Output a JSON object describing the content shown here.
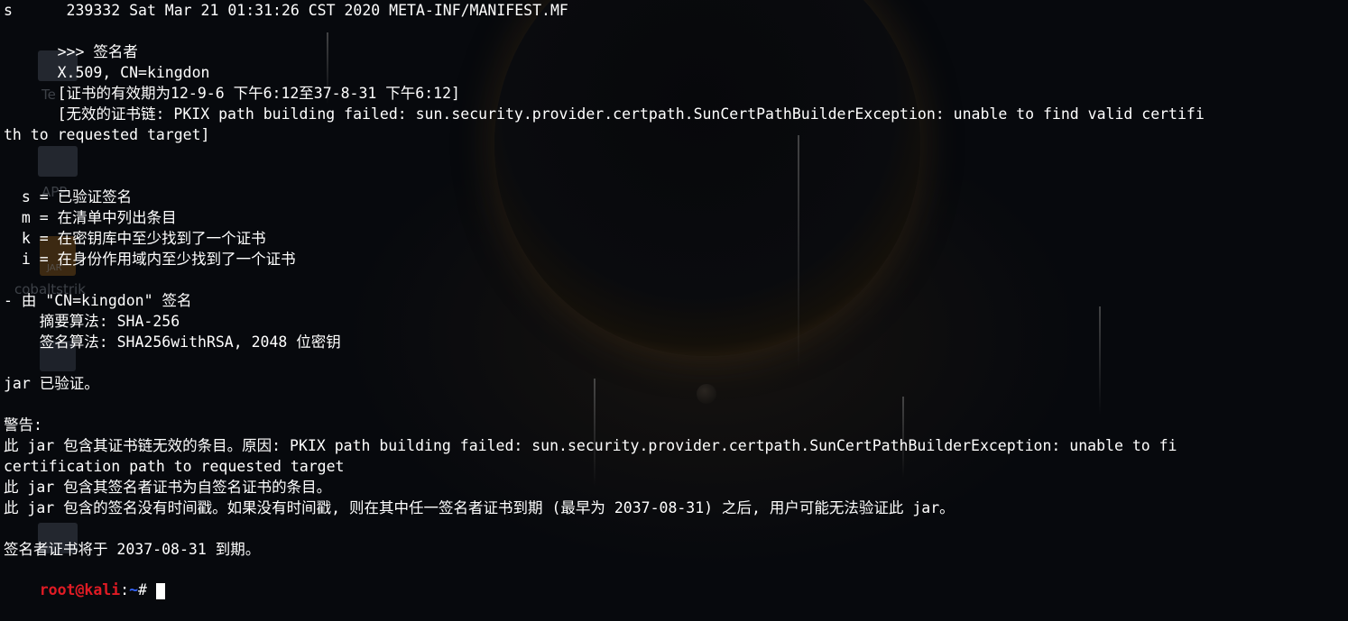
{
  "terminal": {
    "lines": [
      "s      239332 Sat Mar 21 01:31:26 CST 2020 META-INF/MANIFEST.MF",
      "",
      "      >>> 签名者",
      "      X.509, CN=kingdon",
      "      [证书的有效期为12-9-6 下午6:12至37-8-31 下午6:12]",
      "      [无效的证书链: PKIX path building failed: sun.security.provider.certpath.SunCertPathBuilderException: unable to find valid certifi",
      "th to requested target]",
      "",
      "",
      "  s = 已验证签名",
      "  m = 在清单中列出条目",
      "  k = 在密钥库中至少找到了一个证书",
      "  i = 在身份作用域内至少找到了一个证书",
      "",
      "- 由 \"CN=kingdon\" 签名",
      "    摘要算法: SHA-256",
      "    签名算法: SHA256withRSA, 2048 位密钥",
      "",
      "jar 已验证。",
      "",
      "警告:",
      "此 jar 包含其证书链无效的条目。原因: PKIX path building failed: sun.security.provider.certpath.SunCertPathBuilderException: unable to fi",
      "certification path to requested target",
      "此 jar 包含其签名者证书为自签名证书的条目。",
      "此 jar 包含的签名没有时间戳。如果没有时间戳, 则在其中任一签名者证书到期 (最早为 2037-08-31) 之后, 用户可能无法验证此 jar。",
      "",
      "签名者证书将于 2037-08-31 到期。"
    ],
    "prompt": {
      "user_host": "root@kali",
      "path_sep": ":",
      "path": "~",
      "symbol": "# "
    }
  },
  "desktop": {
    "labels": [
      "Te",
      "APP",
      "cobaltstrik"
    ],
    "badge": "JAR"
  }
}
